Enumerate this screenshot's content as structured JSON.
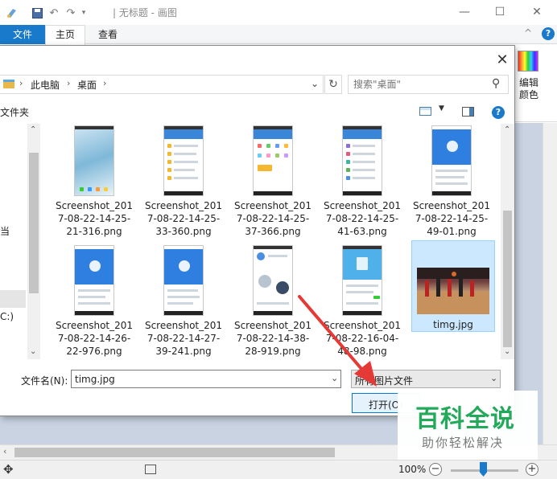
{
  "window": {
    "title": "| 无标题 - 画图",
    "min_glyph": "—",
    "max_glyph": "☐",
    "close_glyph": "✕"
  },
  "ribbon": {
    "tab_file": "文件",
    "tab_home": "主页",
    "tab_view": "查看",
    "edit_colors": "编辑颜色",
    "help": "?",
    "collapse": "^"
  },
  "dialog": {
    "breadcrumbs": [
      "此电脑",
      "桌面"
    ],
    "search_placeholder": "搜索\"桌面\"",
    "toolbar_label": "文件夹",
    "nav_items": [
      "当",
      "C:)"
    ],
    "files": [
      {
        "name": "Screenshot_2017-08-22-14-25-21-316.png",
        "line1": "Screenshot_201",
        "line2": "7-08-22-14-25-",
        "line3": "21-316.png"
      },
      {
        "name": "Screenshot_2017-08-22-14-25-33-360.png",
        "line1": "Screenshot_201",
        "line2": "7-08-22-14-25-",
        "line3": "33-360.png"
      },
      {
        "name": "Screenshot_2017-08-22-14-25-37-366.png",
        "line1": "Screenshot_201",
        "line2": "7-08-22-14-25-",
        "line3": "37-366.png"
      },
      {
        "name": "Screenshot_2017-08-22-14-25-41-63.png",
        "line1": "Screenshot_201",
        "line2": "7-08-22-14-25-",
        "line3": "41-63.png"
      },
      {
        "name": "Screenshot_2017-08-22-14-25-49-01.png",
        "line1": "Screenshot_201",
        "line2": "7-08-22-14-25-",
        "line3": "49-01.png"
      },
      {
        "name": "Screenshot_2017-08-22-14-26-22-976.png",
        "line1": "Screenshot_201",
        "line2": "7-08-22-14-26-",
        "line3": "22-976.png"
      },
      {
        "name": "Screenshot_2017-08-22-14-27-39-241.png",
        "line1": "Screenshot_201",
        "line2": "7-08-22-14-27-",
        "line3": "39-241.png"
      },
      {
        "name": "Screenshot_2017-08-22-14-38-28-919.png",
        "line1": "Screenshot_201",
        "line2": "7-08-22-14-38-",
        "line3": "28-919.png"
      },
      {
        "name": "Screenshot_2017-08-22-16-04-48-98.png",
        "line1": "Screenshot_201",
        "line2": "7-08-22-16-04-",
        "line3": "48-98.png"
      }
    ],
    "selected_file": "timg.jpg",
    "filename_label": "文件名(N):",
    "filename_value": "timg.jpg",
    "filetype_value": "所有图片文件",
    "open_button": "打开(O)",
    "close_glyph": "✕"
  },
  "statusbar": {
    "zoom": "100%",
    "zoom_level_percent": 100
  },
  "watermark": {
    "title": "百科全说",
    "subtitle": "助你轻松解决"
  },
  "colors": {
    "accent": "#1979ca",
    "arrow": "#e53935",
    "watermark_green": "#22a95a"
  }
}
